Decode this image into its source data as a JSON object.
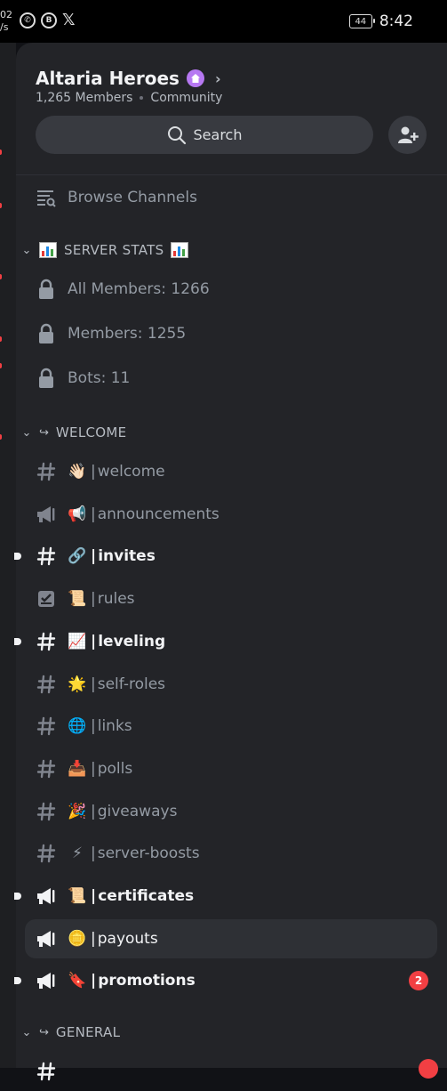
{
  "status_bar": {
    "speed": "02 /s",
    "battery": "44",
    "time": "8:42",
    "icons": [
      "whatsapp-icon",
      "b-app-icon",
      "x-icon"
    ]
  },
  "server": {
    "name": "Altaria Heroes",
    "members": "1,265 Members",
    "type": "Community"
  },
  "search": {
    "label": "Search"
  },
  "browse": {
    "label": "Browse Channels"
  },
  "categories": {
    "stats": {
      "label": "SERVER STATS"
    },
    "welcome": {
      "label": "WELCOME",
      "prefix": "↪"
    },
    "general": {
      "label": "GENERAL",
      "prefix": "↪"
    }
  },
  "stats_channels": [
    {
      "label": "All Members: 1266",
      "icon": "lock-icon"
    },
    {
      "label": "Members: 1255",
      "icon": "lock-icon"
    },
    {
      "label": "Bots: 11",
      "icon": "lock-icon"
    }
  ],
  "channels": [
    {
      "emoji": "👋🏻",
      "name": "welcome",
      "icon": "hashtag-icon",
      "unread": false
    },
    {
      "emoji": "📢",
      "name": "announcements",
      "icon": "megaphone-icon",
      "unread": false
    },
    {
      "emoji": "🔗",
      "name": "invites",
      "icon": "hashtag-icon",
      "unread": true
    },
    {
      "emoji": "📜",
      "name": "rules",
      "icon": "rules-icon",
      "unread": false
    },
    {
      "emoji": "📈",
      "name": "leveling",
      "icon": "hashtag-icon",
      "unread": true
    },
    {
      "emoji": "🌟",
      "name": "self-roles",
      "icon": "hashtag-icon",
      "unread": false
    },
    {
      "emoji": "🌐",
      "name": "links",
      "icon": "hashtag-icon",
      "unread": false
    },
    {
      "emoji": "📥",
      "name": "polls",
      "icon": "hashtag-icon",
      "unread": false
    },
    {
      "emoji": "🎉",
      "name": "giveaways",
      "icon": "hashtag-icon",
      "unread": false
    },
    {
      "emoji": "⚡",
      "name": "server-boosts",
      "icon": "hashtag-icon",
      "unread": false
    },
    {
      "emoji": "📜",
      "name": "certificates",
      "icon": "megaphone-icon",
      "unread": true
    },
    {
      "emoji": "🪙",
      "name": "payouts",
      "icon": "megaphone-icon",
      "unread": false,
      "selected": true
    },
    {
      "emoji": "🔖",
      "name": "promotions",
      "icon": "megaphone-icon",
      "unread": true,
      "mentions": "2"
    }
  ],
  "colors": {
    "background": "#232428",
    "accent_badge": "#b678f2",
    "mention_badge": "#f23f43",
    "muted_text": "#949ba4",
    "unread_text": "#f2f3f5"
  }
}
